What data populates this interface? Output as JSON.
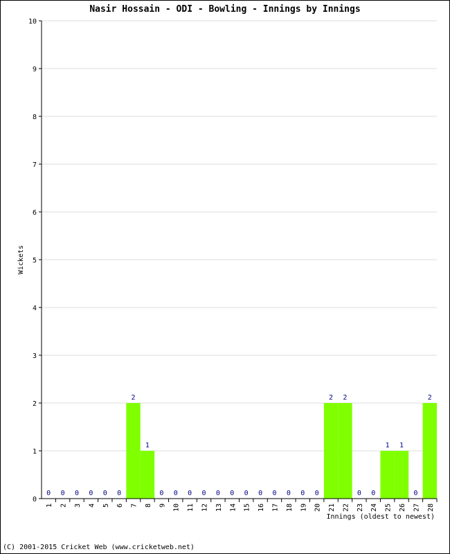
{
  "chart_data": {
    "type": "bar",
    "title": "Nasir Hossain - ODI - Bowling - Innings by Innings",
    "xlabel": "Innings (oldest to newest)",
    "ylabel": "Wickets",
    "ylim": [
      0,
      10
    ],
    "yticks": [
      0,
      1,
      2,
      3,
      4,
      5,
      6,
      7,
      8,
      9,
      10
    ],
    "grid": true,
    "categories": [
      "1",
      "2",
      "3",
      "4",
      "5",
      "6",
      "7",
      "8",
      "9",
      "10",
      "11",
      "12",
      "13",
      "14",
      "15",
      "16",
      "17",
      "18",
      "19",
      "20",
      "21",
      "22",
      "23",
      "24",
      "25",
      "26",
      "27",
      "28"
    ],
    "values": [
      0,
      0,
      0,
      0,
      0,
      0,
      2,
      1,
      0,
      0,
      0,
      0,
      0,
      0,
      0,
      0,
      0,
      0,
      0,
      0,
      2,
      2,
      0,
      0,
      1,
      1,
      0,
      2
    ],
    "colors": {
      "bar": "#80ff00",
      "label": "#000080",
      "grid": "#dddddd"
    }
  },
  "footer": {
    "copyright": "(C) 2001-2015 Cricket Web (www.cricketweb.net)"
  }
}
